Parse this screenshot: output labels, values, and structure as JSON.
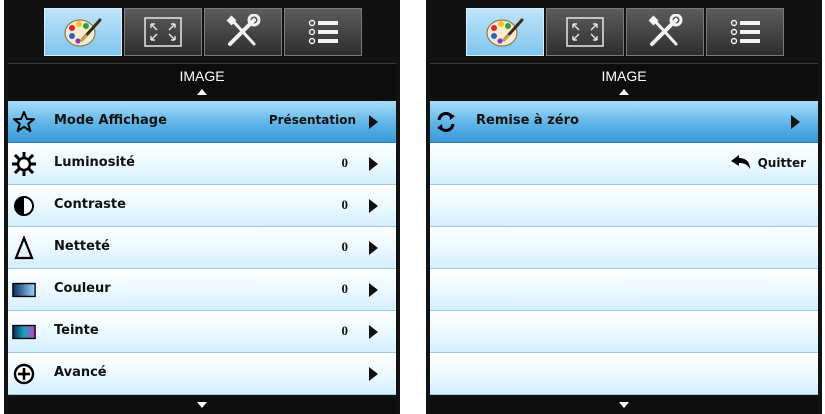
{
  "colors": {
    "selected_row": "#3897d6",
    "row_bg": "#eaf8ff",
    "panel_bg": "#121212",
    "tab_active": "#7fc4ee"
  },
  "left_panel": {
    "tabs": [
      {
        "icon": "palette-icon",
        "active": true
      },
      {
        "icon": "fullscreen-icon",
        "active": false
      },
      {
        "icon": "tools-icon",
        "active": false
      },
      {
        "icon": "list-icon",
        "active": false
      }
    ],
    "title": "IMAGE",
    "rows": [
      {
        "label": "Mode Affichage",
        "value": "Présentation",
        "icon": "star-icon",
        "selected": true
      },
      {
        "label": "Luminosité",
        "value": "0",
        "icon": "brightness-icon"
      },
      {
        "label": "Contraste",
        "value": "0",
        "icon": "contrast-icon"
      },
      {
        "label": "Netteté",
        "value": "0",
        "icon": "sharpness-icon"
      },
      {
        "label": "Couleur",
        "value": "0",
        "icon": "color-icon"
      },
      {
        "label": "Teinte",
        "value": "0",
        "icon": "tint-icon"
      },
      {
        "label": "Avancé",
        "value": "",
        "icon": "advanced-plus-icon"
      }
    ]
  },
  "right_panel": {
    "tabs": [
      {
        "icon": "palette-icon",
        "active": true
      },
      {
        "icon": "fullscreen-icon",
        "active": false
      },
      {
        "icon": "tools-icon",
        "active": false
      },
      {
        "icon": "list-icon",
        "active": false
      }
    ],
    "title": "IMAGE",
    "rows": [
      {
        "label": "Remise à zéro",
        "icon": "reset-icon",
        "selected": true
      },
      {
        "quit_label": "Quitter",
        "icon": "back-arrow-icon"
      }
    ]
  }
}
